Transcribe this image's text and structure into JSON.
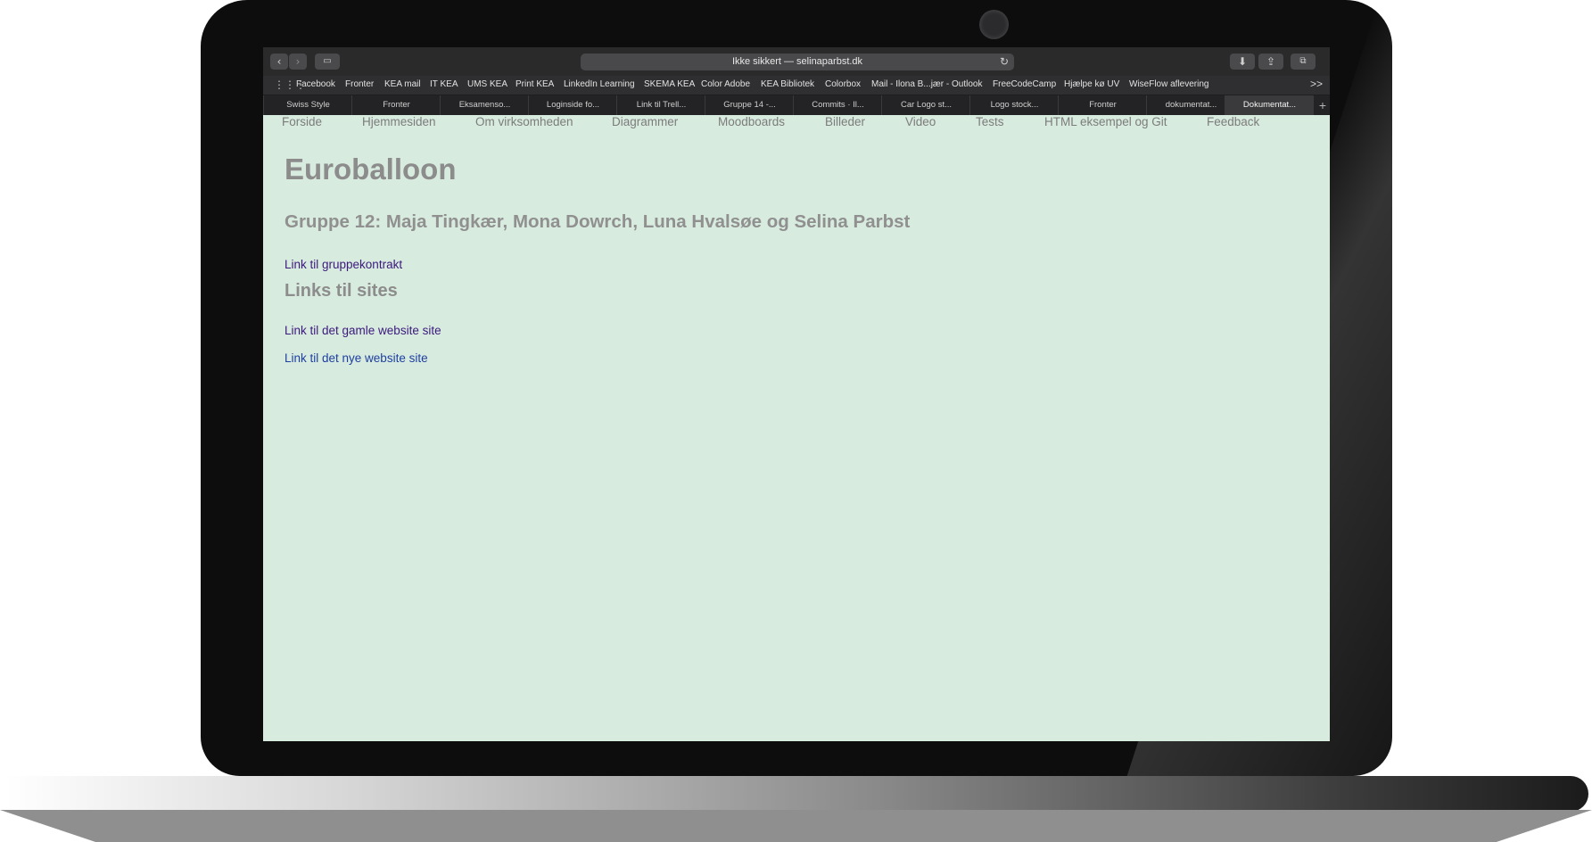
{
  "browser": {
    "url_display": "Ikke sikkert — selinaparbst.dk",
    "reload_icon": "↻",
    "bookmarks": [
      "Facebook",
      "Fronter",
      "KEA mail",
      "IT KEA",
      "UMS KEA",
      "Print KEA",
      "LinkedIn Learning",
      "SKEMA KEA",
      "Color Adobe",
      "KEA Bibliotek",
      "Colorbox",
      "Mail - Ilona B...jær - Outlook",
      "FreeCodeCamp",
      "Hjælpe kø UV",
      "WiseFlow aflevering"
    ],
    "bookmarks_more": ">>",
    "tabs": [
      "Swiss Style",
      "Fronter",
      "Eksamenso...",
      "Loginside fo...",
      "Link til Trell...",
      "Gruppe 14 -...",
      "Commits · Il...",
      "Car Logo st...",
      "Logo stock...",
      "Fronter",
      "dokumentat...",
      "Dokumentat..."
    ],
    "active_tab_index": 11,
    "new_tab_symbol": "+"
  },
  "page": {
    "nav": [
      "Forside",
      "Hjemmesiden",
      "Om virksomheden",
      "Diagrammer",
      "Moodboards",
      "Billeder",
      "Video",
      "Tests",
      "HTML eksempel og Git",
      "Feedback"
    ],
    "title": "Euroballoon",
    "subtitle": "Gruppe 12: Maja Tingkær, Mona Dowrch, Luna Hvalsøe og Selina Parbst",
    "group_contract_link": "Link til gruppekontrakt",
    "sites_heading": "Links til sites",
    "old_site_link": "Link til det gamle website site",
    "new_site_link": "Link til det nye website site"
  },
  "colors": {
    "page_background": "#d8ebdf",
    "heading_gray": "#8c8c8c",
    "visited_link": "#3b1a7c",
    "link": "#1e3fa0"
  }
}
